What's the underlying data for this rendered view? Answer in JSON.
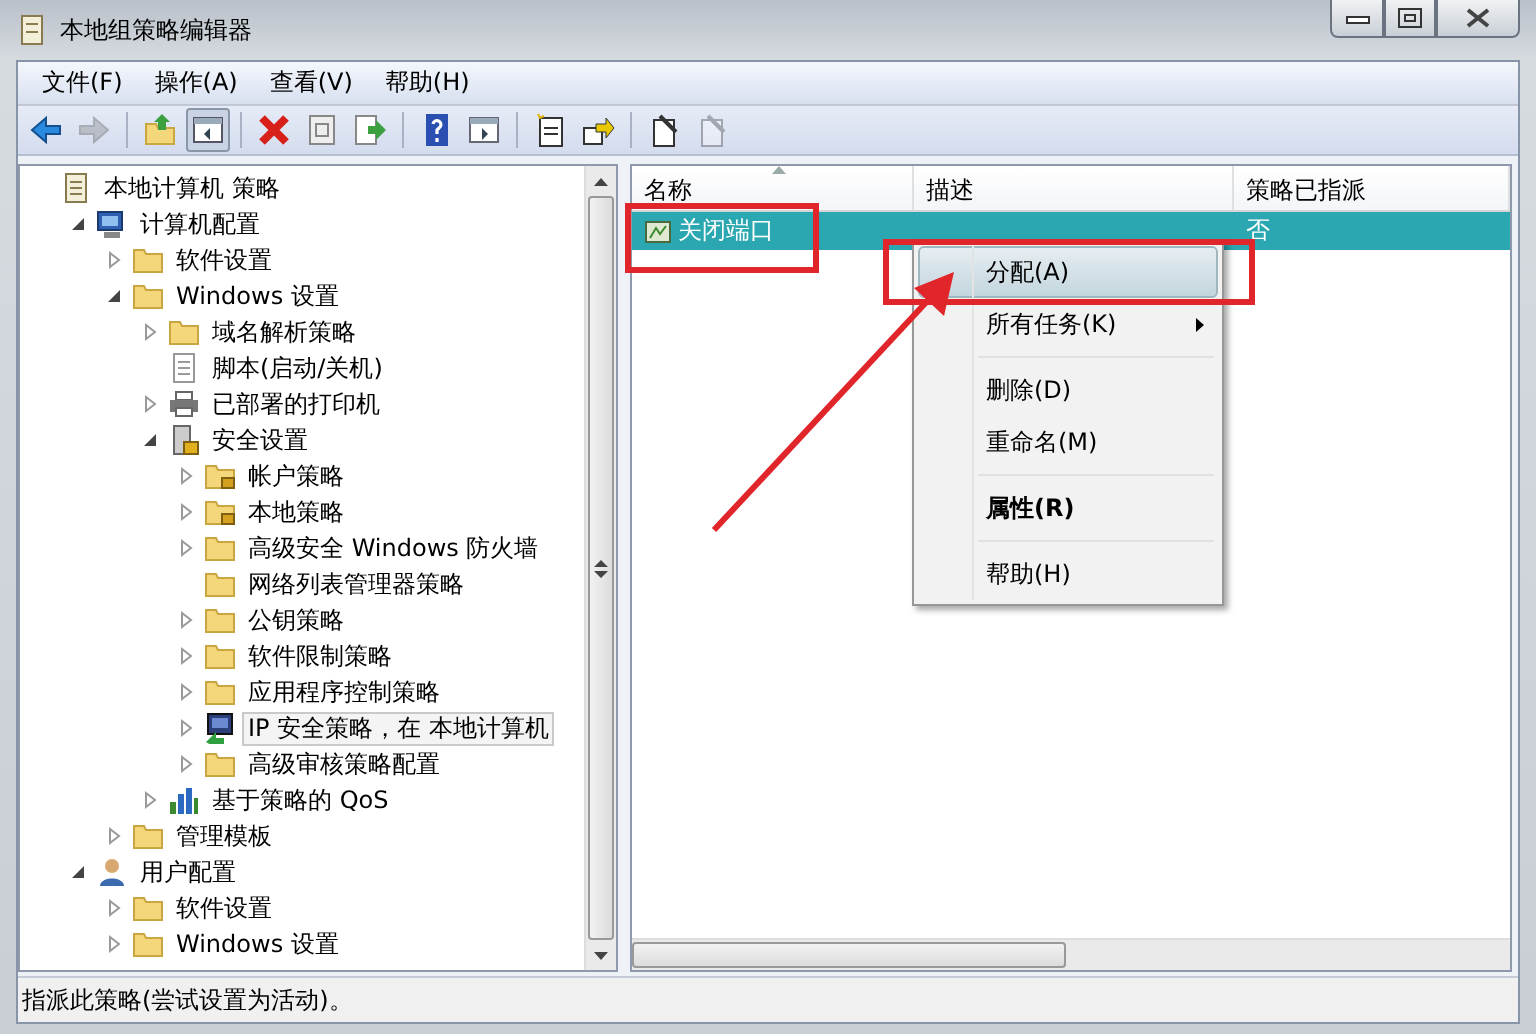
{
  "window": {
    "title": "本地组策略编辑器"
  },
  "menu": [
    {
      "label": "文件(F)"
    },
    {
      "label": "操作(A)"
    },
    {
      "label": "查看(V)"
    },
    {
      "label": "帮助(H)"
    }
  ],
  "toolbar": [
    {
      "kind": "back",
      "disabled": false,
      "pressed": false
    },
    {
      "kind": "forward",
      "disabled": true,
      "pressed": false
    },
    {
      "kind": "separator"
    },
    {
      "kind": "up",
      "disabled": false,
      "pressed": false
    },
    {
      "kind": "tree",
      "disabled": false,
      "pressed": true
    },
    {
      "kind": "separator"
    },
    {
      "kind": "delete",
      "disabled": false,
      "pressed": false
    },
    {
      "kind": "properties",
      "disabled": false,
      "pressed": false
    },
    {
      "kind": "export",
      "disabled": false,
      "pressed": false
    },
    {
      "kind": "separator"
    },
    {
      "kind": "help",
      "disabled": false,
      "pressed": false
    },
    {
      "kind": "panel",
      "disabled": false,
      "pressed": false
    },
    {
      "kind": "separator"
    },
    {
      "kind": "new",
      "disabled": false,
      "pressed": false
    },
    {
      "kind": "move",
      "disabled": false,
      "pressed": false
    },
    {
      "kind": "separator"
    },
    {
      "kind": "edit",
      "disabled": false,
      "pressed": false
    },
    {
      "kind": "edit",
      "disabled": true,
      "pressed": false
    }
  ],
  "tree": [
    {
      "label": "本地计算机 策略",
      "kind": "doc",
      "expandable": false,
      "selected": false,
      "children": [
        {
          "label": "计算机配置",
          "kind": "computer",
          "expandable": true,
          "expanded": true,
          "selected": false,
          "children": [
            {
              "label": "软件设置",
              "kind": "folder",
              "expandable": true,
              "expanded": false,
              "selected": false
            },
            {
              "label": "Windows 设置",
              "kind": "folder",
              "expandable": true,
              "expanded": true,
              "selected": false,
              "children": [
                {
                  "label": "域名解析策略",
                  "kind": "folder",
                  "expandable": true,
                  "expanded": false,
                  "selected": false
                },
                {
                  "label": "脚本(启动/关机)",
                  "kind": "script",
                  "expandable": false,
                  "selected": false
                },
                {
                  "label": "已部署的打印机",
                  "kind": "printer",
                  "expandable": true,
                  "expanded": false,
                  "selected": false
                },
                {
                  "label": "安全设置",
                  "kind": "security",
                  "expandable": true,
                  "expanded": true,
                  "selected": false,
                  "children": [
                    {
                      "label": "帐户策略",
                      "kind": "lockfolder",
                      "expandable": true,
                      "expanded": false,
                      "selected": false
                    },
                    {
                      "label": "本地策略",
                      "kind": "lockfolder",
                      "expandable": true,
                      "expanded": false,
                      "selected": false
                    },
                    {
                      "label": "高级安全 Windows 防火墙",
                      "kind": "folder",
                      "expandable": true,
                      "expanded": false,
                      "selected": false
                    },
                    {
                      "label": "网络列表管理器策略",
                      "kind": "folder",
                      "expandable": false,
                      "selected": false
                    },
                    {
                      "label": "公钥策略",
                      "kind": "folder",
                      "expandable": true,
                      "expanded": false,
                      "selected": false
                    },
                    {
                      "label": "软件限制策略",
                      "kind": "folder",
                      "expandable": true,
                      "expanded": false,
                      "selected": false
                    },
                    {
                      "label": "应用程序控制策略",
                      "kind": "folder",
                      "expandable": true,
                      "expanded": false,
                      "selected": false
                    },
                    {
                      "label": "IP 安全策略，在 本地计算机",
                      "kind": "ip",
                      "expandable": true,
                      "expanded": false,
                      "selected": true
                    },
                    {
                      "label": "高级审核策略配置",
                      "kind": "folder",
                      "expandable": true,
                      "expanded": false,
                      "selected": false
                    }
                  ]
                },
                {
                  "label": "基于策略的 QoS",
                  "kind": "qos",
                  "expandable": true,
                  "expanded": false,
                  "selected": false
                }
              ]
            },
            {
              "label": "管理模板",
              "kind": "folder",
              "expandable": true,
              "expanded": false,
              "selected": false
            }
          ]
        },
        {
          "label": "用户配置",
          "kind": "user",
          "expandable": true,
          "expanded": true,
          "selected": false,
          "children": [
            {
              "label": "软件设置",
              "kind": "folder",
              "expandable": true,
              "expanded": false,
              "selected": false
            },
            {
              "label": "Windows 设置",
              "kind": "folder",
              "expandable": true,
              "expanded": false,
              "selected": false
            }
          ]
        }
      ]
    }
  ],
  "list": {
    "columns": [
      {
        "label": "名称",
        "sorted": true
      },
      {
        "label": "描述",
        "sorted": false
      },
      {
        "label": "策略已指派",
        "sorted": false
      }
    ],
    "rows": [
      {
        "name": "关闭端口",
        "assigned": "否",
        "selected": true
      }
    ]
  },
  "context_menu": [
    {
      "kind": "item",
      "label": "分配(A)",
      "highlighted": true,
      "default": false,
      "submenu": false
    },
    {
      "kind": "item",
      "label": "所有任务(K)",
      "highlighted": false,
      "default": false,
      "submenu": true
    },
    {
      "kind": "separator"
    },
    {
      "kind": "item",
      "label": "删除(D)",
      "highlighted": false,
      "default": false,
      "submenu": false
    },
    {
      "kind": "item",
      "label": "重命名(M)",
      "highlighted": false,
      "default": false,
      "submenu": false
    },
    {
      "kind": "separator"
    },
    {
      "kind": "item",
      "label": "属性(R)",
      "highlighted": false,
      "default": true,
      "submenu": false
    },
    {
      "kind": "separator"
    },
    {
      "kind": "item",
      "label": "帮助(H)",
      "highlighted": false,
      "default": false,
      "submenu": false
    }
  ],
  "status_bar": "指派此策略(尝试设置为活动)。"
}
